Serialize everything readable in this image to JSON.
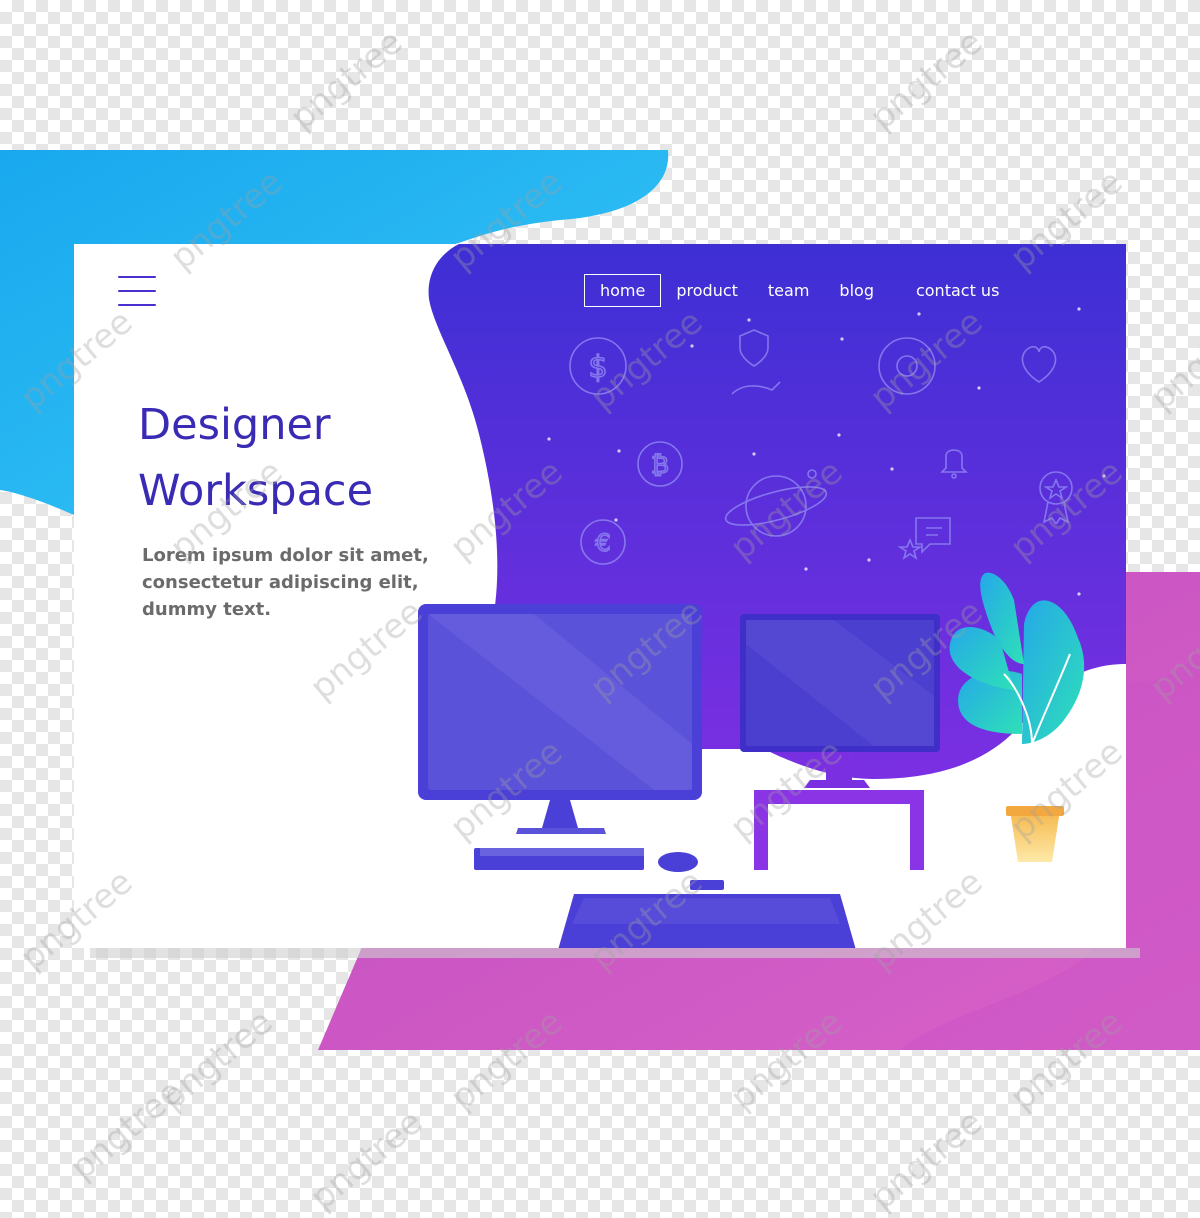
{
  "nav": {
    "items": [
      {
        "label": "home",
        "active": true
      },
      {
        "label": "product",
        "active": false
      },
      {
        "label": "team",
        "active": false
      },
      {
        "label": "blog",
        "active": false
      },
      {
        "label": "contact us",
        "active": false
      }
    ]
  },
  "hero": {
    "title_line1": "Designer",
    "title_line2": "Workspace",
    "description": "Lorem ipsum dolor sit amet, consectetur adipiscing elit, dummy text."
  },
  "watermark": {
    "text": "pngtree"
  },
  "colors": {
    "blue_blob": "#2bbcf2",
    "pink_blob": "#d258c6",
    "purple_top": "#3f2fd6",
    "purple_bottom": "#7a2fe0",
    "title": "#3a2bb5"
  },
  "icons": [
    "dollar-coin-icon",
    "shield-hand-icon",
    "at-sign-icon",
    "heart-icon",
    "bitcoin-icon",
    "bell-icon",
    "planet-icon",
    "award-badge-icon",
    "euro-coin-icon",
    "chat-star-icon",
    "hamburger-menu-icon"
  ]
}
